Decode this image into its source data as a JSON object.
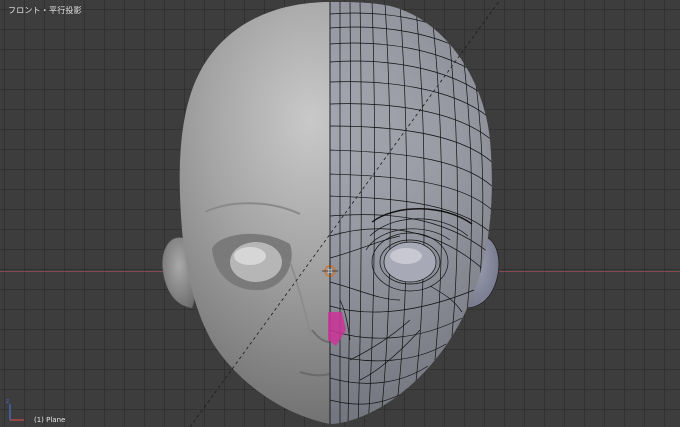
{
  "viewport": {
    "view_name": "フロント・平行投影",
    "active_object": "(1) Plane"
  },
  "colors": {
    "background": "#3d3d3d",
    "grid_line": "#333333",
    "x_axis": "#8c4c52",
    "mesh_shaded": "#9a9a9a",
    "wire": "#111111",
    "selection": "#cc3399",
    "cursor": "#d07020"
  },
  "icons": [
    "3d-cursor-icon",
    "axis-gizmo-icon"
  ]
}
